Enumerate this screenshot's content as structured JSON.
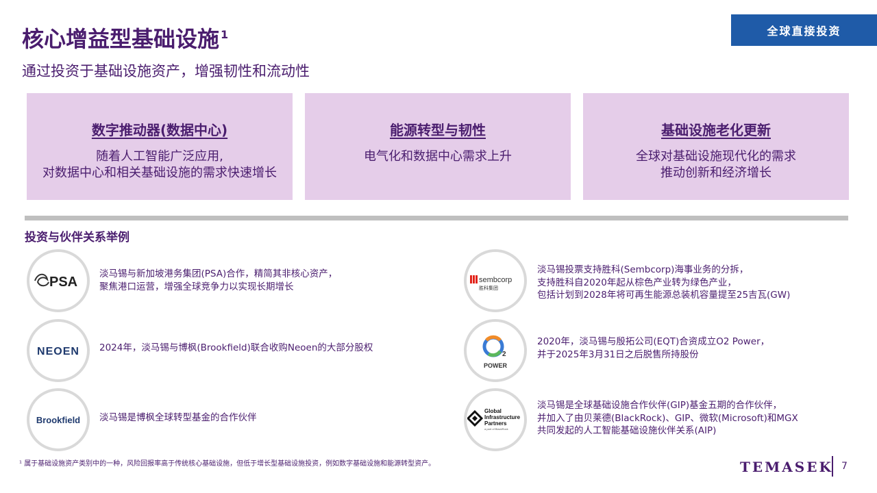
{
  "header": {
    "tag": "全球直接投资",
    "title": "核心增益型基础设施",
    "title_sup": "1",
    "subtitle": "通过投资于基础设施资产，增强韧性和流动性"
  },
  "cards": [
    {
      "heading": "数字推动器(数据中心)",
      "lines": [
        "随着人工智能广泛应用,",
        "对数据中心和相关基础设施的需求快速增长"
      ]
    },
    {
      "heading": "能源转型与韧性",
      "lines": [
        "电气化和数据中心需求上升"
      ]
    },
    {
      "heading": "基础设施老化更新",
      "lines": [
        "全球对基础设施现代化的需求",
        "推动创新和经济增长"
      ]
    }
  ],
  "section_heading": "投资与伙伴关系举例",
  "partners": {
    "psa": {
      "logo": "PSA",
      "lines": [
        "淡马锡与新加坡港务集团(PSA)合作，精简其非核心资产，",
        "聚焦港口运营，增强全球竞争力以实现长期增长"
      ]
    },
    "neoen": {
      "logo": "NEOEN",
      "lines": [
        "2024年，淡马锡与博枫(Brookfield)联合收购Neoen的大部分股权"
      ]
    },
    "brookfield": {
      "logo": "Brookfield",
      "lines": [
        "淡马锡是博枫全球转型基金的合作伙伴"
      ]
    },
    "sembcorp": {
      "logo": "sembcorp",
      "logo_sub": "胜科集团",
      "lines": [
        "淡马锡投票支持胜科(Sembcorp)海事业务的分拆，",
        "支持胜科自2020年起从棕色产业转为绿色产业，",
        "包括计划到2028年将可再生能源总装机容量提至25吉瓦(GW)"
      ]
    },
    "o2power": {
      "logo": "O",
      "logo_sub_script": "2",
      "logo_sub": "POWER",
      "lines": [
        "2020年，淡马锡与殷拓公司(EQT)合资成立O2 Power，",
        "并于2025年3月31日之后脱售所持股份"
      ]
    },
    "gip": {
      "logo_lines": [
        "Global",
        "Infrastructure",
        "Partners"
      ],
      "logo_sub": "a part of BlackRock",
      "lines": [
        "淡马锡是全球基础设施合作伙伴(GIP)基金五期的合作伙伴，",
        "并加入了由贝莱德(BlackRock)、GIP、微软(Microsoft)和MGX",
        "共同发起的人工智能基础设施伙伴关系(AIP)"
      ]
    }
  },
  "footnote": "¹ 属于基础设施资产类别中的一种，风险回报率高于传统核心基础设施，但低于增长型基础设施投资，例如数字基础设施和能源转型资产。",
  "footer": {
    "brand": "TEMASEK",
    "page": "7"
  },
  "colors": {
    "primary": "#4a1d6e",
    "tag_bg": "#1f5ba8",
    "card_bg": "#e5cde9",
    "divider": "#bfbfbf"
  }
}
